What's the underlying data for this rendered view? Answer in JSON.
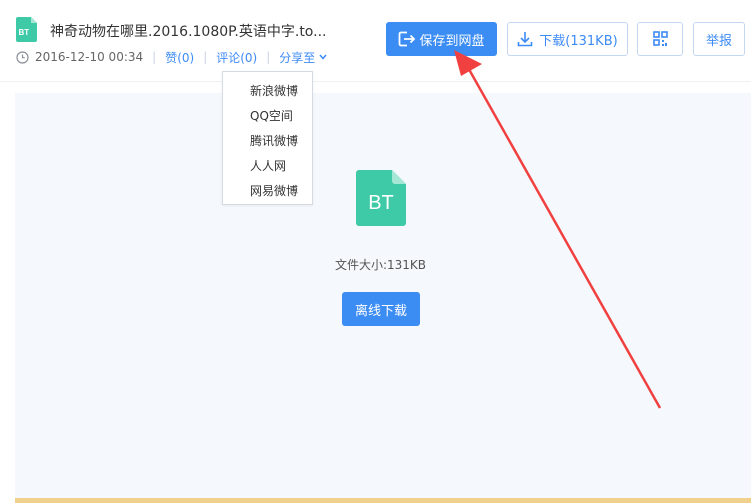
{
  "file": {
    "icon_text": "BT",
    "title": "神奇动物在哪里.2016.1080P.英语中字.to...",
    "date": "2016-12-10 00:34",
    "like": "赞(0)",
    "comment": "评论(0)",
    "share": "分享至"
  },
  "toolbar": {
    "save_label": "保存到网盘",
    "download_label": "下载(131KB)",
    "report_label": "举报"
  },
  "share_menu": {
    "items": [
      "新浪微博",
      "QQ空间",
      "腾讯微博",
      "人人网",
      "网易微博"
    ]
  },
  "main": {
    "icon_text": "BT",
    "size_text": "文件大小:131KB",
    "offline_label": "离线下载"
  },
  "colors": {
    "accent": "#3b8cf3",
    "bt_icon": "#3ec9a7",
    "annotation": "#f04040"
  },
  "icons": [
    "bt-file-icon",
    "clock-icon",
    "chevron-down-icon",
    "save-to-cloud-icon",
    "download-icon",
    "qr-code-icon"
  ]
}
